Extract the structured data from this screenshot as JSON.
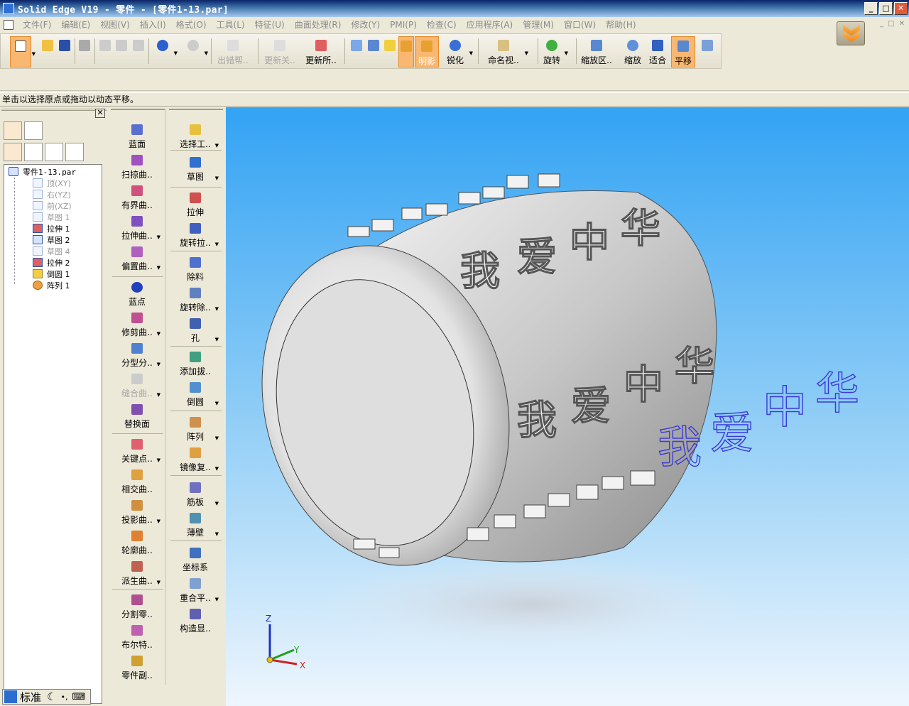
{
  "window": {
    "title": "Solid Edge V19 - 零件 - [零件1-13.par]",
    "minimize": "_",
    "maximize": "□",
    "close": "✕",
    "mdi": [
      "_",
      "□",
      "✕"
    ]
  },
  "menu": [
    "文件(F)",
    "编辑(E)",
    "视图(V)",
    "插入(I)",
    "格式(O)",
    "工具(L)",
    "特征(U)",
    "曲面处理(R)",
    "修改(Y)",
    "PMI(P)",
    "检查(C)",
    "应用程序(A)",
    "管理(M)",
    "窗口(W)",
    "帮助(H)"
  ],
  "toolbar": {
    "error_help": "出错帮..",
    "update_links": "更新关..",
    "update_all": "更新所..",
    "shaded": "明影",
    "sharpen": "锐化",
    "named_views": "命名视..",
    "rotate": "旋转",
    "zoom_area": "缩放区..",
    "zoom": "缩放",
    "fit": "适合",
    "pan": "平移"
  },
  "prompt": "单击以选择原点或拖动以动态平移。",
  "tree": {
    "root": "零件1-13.par",
    "items": [
      {
        "label": "顶(XY)",
        "dim": true
      },
      {
        "label": "右(YZ)",
        "dim": true
      },
      {
        "label": "前(XZ)",
        "dim": true
      },
      {
        "label": "草图 1",
        "dim": true
      },
      {
        "label": "拉伸 1",
        "dim": false
      },
      {
        "label": "草图 2",
        "dim": false
      },
      {
        "label": "草图 4",
        "dim": true
      },
      {
        "label": "拉伸 2",
        "dim": false
      },
      {
        "label": "倒圆 1",
        "dim": false
      },
      {
        "label": "阵列 1",
        "dim": false
      }
    ]
  },
  "ime": {
    "mode": "标准"
  },
  "palette": {
    "col1": [
      "蓝面",
      "扫掠曲..",
      "有界曲..",
      "拉伸曲..",
      "偏置曲..",
      "蓝点",
      "修剪曲..",
      "分型分..",
      "缝合曲..",
      "替换面",
      "关键点..",
      "相交曲..",
      "投影曲..",
      "轮廓曲..",
      "派生曲..",
      "分割零..",
      "布尔特..",
      "零件副.."
    ],
    "col2": [
      "选择工..",
      "草图",
      "拉伸",
      "旋转拉..",
      "除料",
      "旋转除..",
      "孔",
      "添加拔..",
      "倒圆",
      "阵列",
      "镜像复..",
      "筋板",
      "薄壁",
      "坐标系",
      "重合平..",
      "构造显.."
    ]
  },
  "viewport": {
    "watermark": [
      "我",
      "爱",
      "中",
      "华"
    ],
    "axes": {
      "z": "Z",
      "y": "Y",
      "x": "X"
    }
  },
  "colors": {
    "accent_active": "#F9B872",
    "sky_top": "#33A3F4",
    "watermark": "#3A3AD8"
  }
}
